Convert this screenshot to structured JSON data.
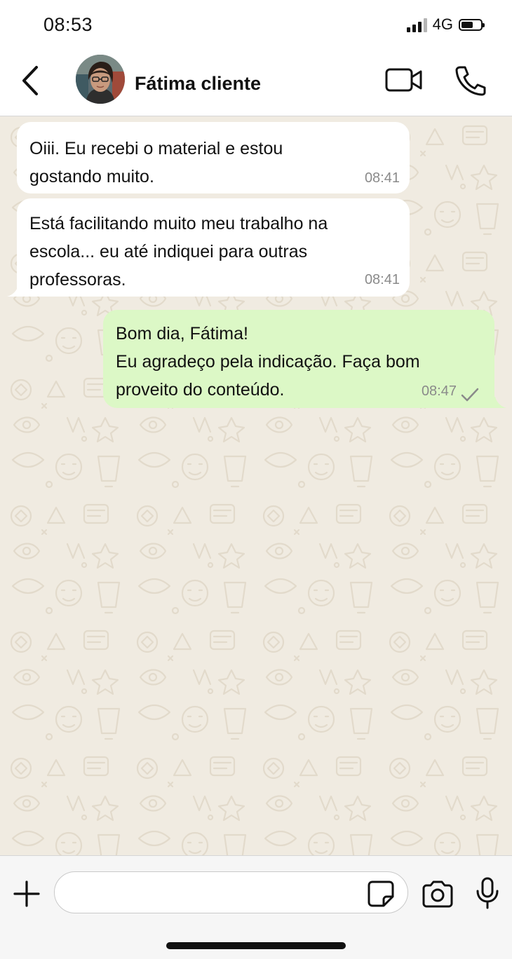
{
  "status_bar": {
    "time": "08:53",
    "network": "4G",
    "icons": [
      "signal-icon",
      "battery-icon"
    ]
  },
  "header": {
    "contact_name": "Fátima cliente",
    "icons": [
      "back-arrow-icon",
      "avatar-photo",
      "video-camera-icon",
      "phone-icon"
    ]
  },
  "messages": [
    {
      "direction": "incoming",
      "text": "Oiii. Eu recebi o material e estou\ngostando muito.",
      "time": "08:41"
    },
    {
      "direction": "incoming",
      "text": "Está facilitando muito meu trabalho na\nescola... eu até indiquei para outras\nprofessoras.",
      "time": "08:41"
    },
    {
      "direction": "outgoing",
      "text": "Bom dia, Fátima!\nEu agradeço pela indicação. Faça bom\nproveito do conteúdo.",
      "time": "08:47",
      "status_icon": "single-check-icon"
    }
  ],
  "composer": {
    "placeholder": "",
    "value": "",
    "icons": [
      "plus-icon",
      "sticker-icon",
      "camera-icon",
      "microphone-icon"
    ]
  },
  "colors": {
    "chat_background": "#f0ebe1",
    "incoming_bubble": "#ffffff",
    "outgoing_bubble": "#dcf8c6",
    "timestamp": "#8a8a8a"
  }
}
